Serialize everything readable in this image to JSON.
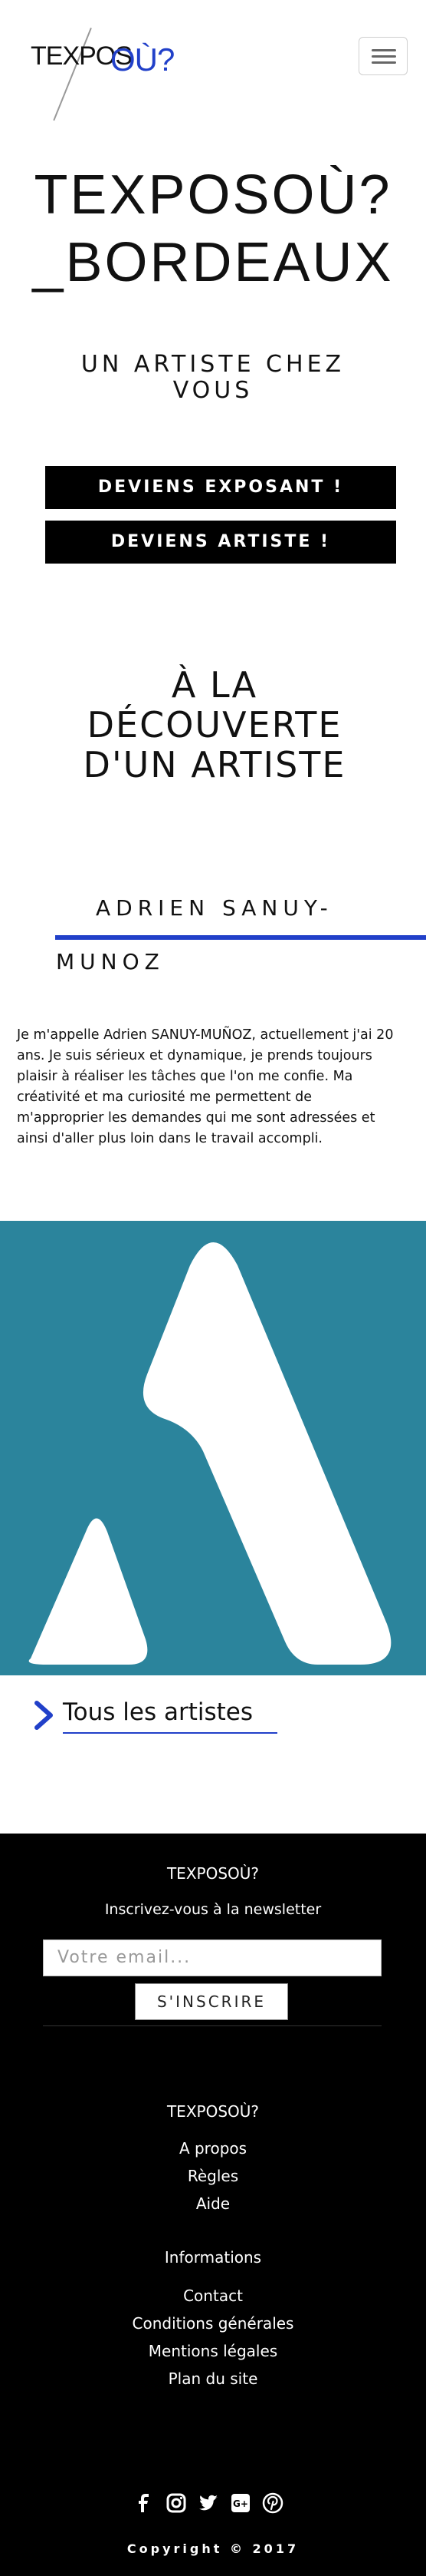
{
  "header": {
    "logo_text": "TEXPOS",
    "logo_accent": "OÙ?",
    "menu_label": "menu"
  },
  "hero": {
    "title_line1": "TEXPOSOÙ?",
    "title_line2": "_BORDEAUX",
    "subtitle_line1": "UN ARTISTE CHEZ",
    "subtitle_line2": "VOUS"
  },
  "cta": {
    "exposant": "DEVIENS EXPOSANT !",
    "artiste": "DEVIENS ARTISTE !"
  },
  "discover": {
    "line1": "À LA",
    "line2": "DÉCOUVERTE",
    "line3": "D'UN ARTISTE"
  },
  "artist": {
    "name_part1": "ADRIEN SANUY-",
    "name_part2": "MUNOZ",
    "bio": "Je m'appelle Adrien SANUY-MUÑOZ, actuellement j'ai 20 ans. Je suis sérieux et dynamique, je prends toujours plaisir à réaliser les tâches que l'on me confie. Ma créativité et ma curiosité me permettent de m'approprier les demandes qui me sont adressées et ainsi d'aller plus loin dans le travail accompli.",
    "artwork_bg": "#2b849c"
  },
  "all_artists": {
    "label": "Tous les artistes"
  },
  "footer": {
    "brand": "TEXPOSOÙ?",
    "newsletter_label": "Inscrivez-vous à la newsletter",
    "email_placeholder": "Votre email...",
    "subscribe": "S'INSCRIRE",
    "brand2": "TEXPOSOÙ?",
    "links1": [
      "A propos",
      "Règles",
      "Aide"
    ],
    "info_title": "Informations",
    "links2": [
      "Contact",
      "Conditions générales",
      "Mentions légales",
      "Plan du site"
    ],
    "socials": [
      "facebook-icon",
      "instagram-icon",
      "twitter-icon",
      "google-plus-icon",
      "pinterest-icon"
    ],
    "copyright": "Copyright © 2017"
  },
  "colors": {
    "accent": "#2140c9",
    "artwork": "#2b849c",
    "footer_bg": "#000000"
  }
}
